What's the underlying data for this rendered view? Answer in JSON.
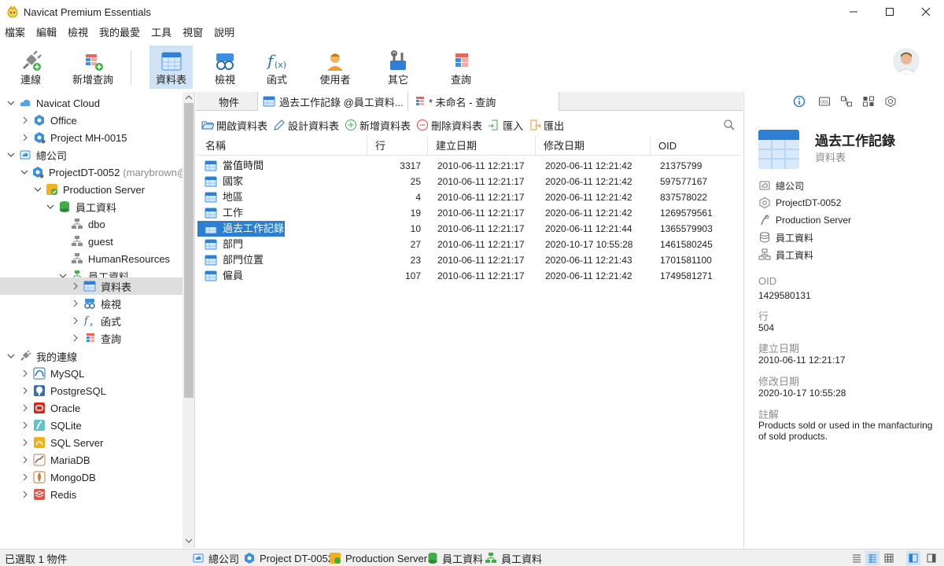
{
  "window": {
    "title": "Navicat Premium Essentials",
    "minimize_icon": "minimize-icon",
    "maximize_icon": "maximize-icon",
    "close_icon": "close-icon"
  },
  "menu": [
    "檔案",
    "編輯",
    "檢視",
    "我的最愛",
    "工具",
    "視窗",
    "說明"
  ],
  "toolbar": {
    "connect": "連線",
    "new_query": "新增查詢",
    "tables": "資料表",
    "views": "檢視",
    "functions": "函式",
    "users": "使用者",
    "others": "其它",
    "queries": "查詢"
  },
  "tree": {
    "cloud": "Navicat Cloud",
    "office": "Office",
    "project_mh": "Project MH-0015",
    "company": "總公司",
    "project_dt": "ProjectDT-0052",
    "project_dt_user": "(marybrown@",
    "production_server": "Production Server",
    "db_employee": "員工資料",
    "schema_dbo": "dbo",
    "schema_guest": "guest",
    "schema_hr": "HumanResources",
    "schema_employee": "員工資料",
    "node_tables": "資料表",
    "node_views": "檢視",
    "node_functions": "函式",
    "node_queries": "查詢",
    "my_connections": "我的連線",
    "conn_mysql": "MySQL",
    "conn_postgres": "PostgreSQL",
    "conn_oracle": "Oracle",
    "conn_sqlite": "SQLite",
    "conn_sqlserver": "SQL Server",
    "conn_mariadb": "MariaDB",
    "conn_mongodb": "MongoDB",
    "conn_redis": "Redis"
  },
  "tabs": {
    "objects": "物件",
    "table_tab": "過去工作記錄 @員工資料...",
    "query_tab": "* 未命名 - 查詢"
  },
  "object_toolbar": {
    "open": "開啟資料表",
    "design": "設計資料表",
    "new": "新增資料表",
    "delete": "刪除資料表",
    "import": "匯入",
    "export": "匯出"
  },
  "grid": {
    "headers": {
      "name": "名稱",
      "rows": "行",
      "created": "建立日期",
      "modified": "修改日期",
      "oid": "OID"
    },
    "rows": [
      {
        "name": "當值時間",
        "rows": "3317",
        "created": "2010-06-11 12:21:17",
        "modified": "2020-06-11 12:21:42",
        "oid": "21375799"
      },
      {
        "name": "國家",
        "rows": "25",
        "created": "2010-06-11 12:21:17",
        "modified": "2020-06-11 12:21:42",
        "oid": "597577167"
      },
      {
        "name": "地區",
        "rows": "4",
        "created": "2010-06-11 12:21:17",
        "modified": "2020-06-11 12:21:42",
        "oid": "837578022"
      },
      {
        "name": "工作",
        "rows": "19",
        "created": "2010-06-11 12:21:17",
        "modified": "2020-06-11 12:21:42",
        "oid": "1269579561"
      },
      {
        "name": "過去工作記錄",
        "rows": "10",
        "created": "2010-06-11 12:21:17",
        "modified": "2020-06-11 12:21:44",
        "oid": "1365579903"
      },
      {
        "name": "部門",
        "rows": "27",
        "created": "2010-06-11 12:21:17",
        "modified": "2020-10-17 10:55:28",
        "oid": "1461580245"
      },
      {
        "name": "部門位置",
        "rows": "23",
        "created": "2010-06-11 12:21:17",
        "modified": "2020-06-11 12:21:43",
        "oid": "1701581100"
      },
      {
        "name": "僱員",
        "rows": "107",
        "created": "2010-06-11 12:21:17",
        "modified": "2020-06-11 12:21:42",
        "oid": "1749581271"
      }
    ]
  },
  "info": {
    "title": "過去工作記錄",
    "subtitle": "資料表",
    "path": [
      "總公司",
      "ProjectDT-0052",
      "Production Server",
      "員工資料",
      "員工資料"
    ],
    "oid_label": "OID",
    "oid": "1429580131",
    "rows_label": "行",
    "rows": "504",
    "created_label": "建立日期",
    "created": "2010-06-11 12:21:17",
    "modified_label": "修改日期",
    "modified": "2020-10-17 10:55:28",
    "comment_label": "註解",
    "comment": "Products sold or used in the manfacturing of sold products."
  },
  "status": {
    "selected": "已選取 1 物件",
    "crumbs": [
      "總公司",
      "Project DT-0052",
      "Production Server",
      "員工資料",
      "員工資料"
    ]
  },
  "colors": {
    "accent": "#2a7fd0",
    "active_toolbar": "#cfe3f4",
    "table_icon": "#3d8fe0"
  }
}
